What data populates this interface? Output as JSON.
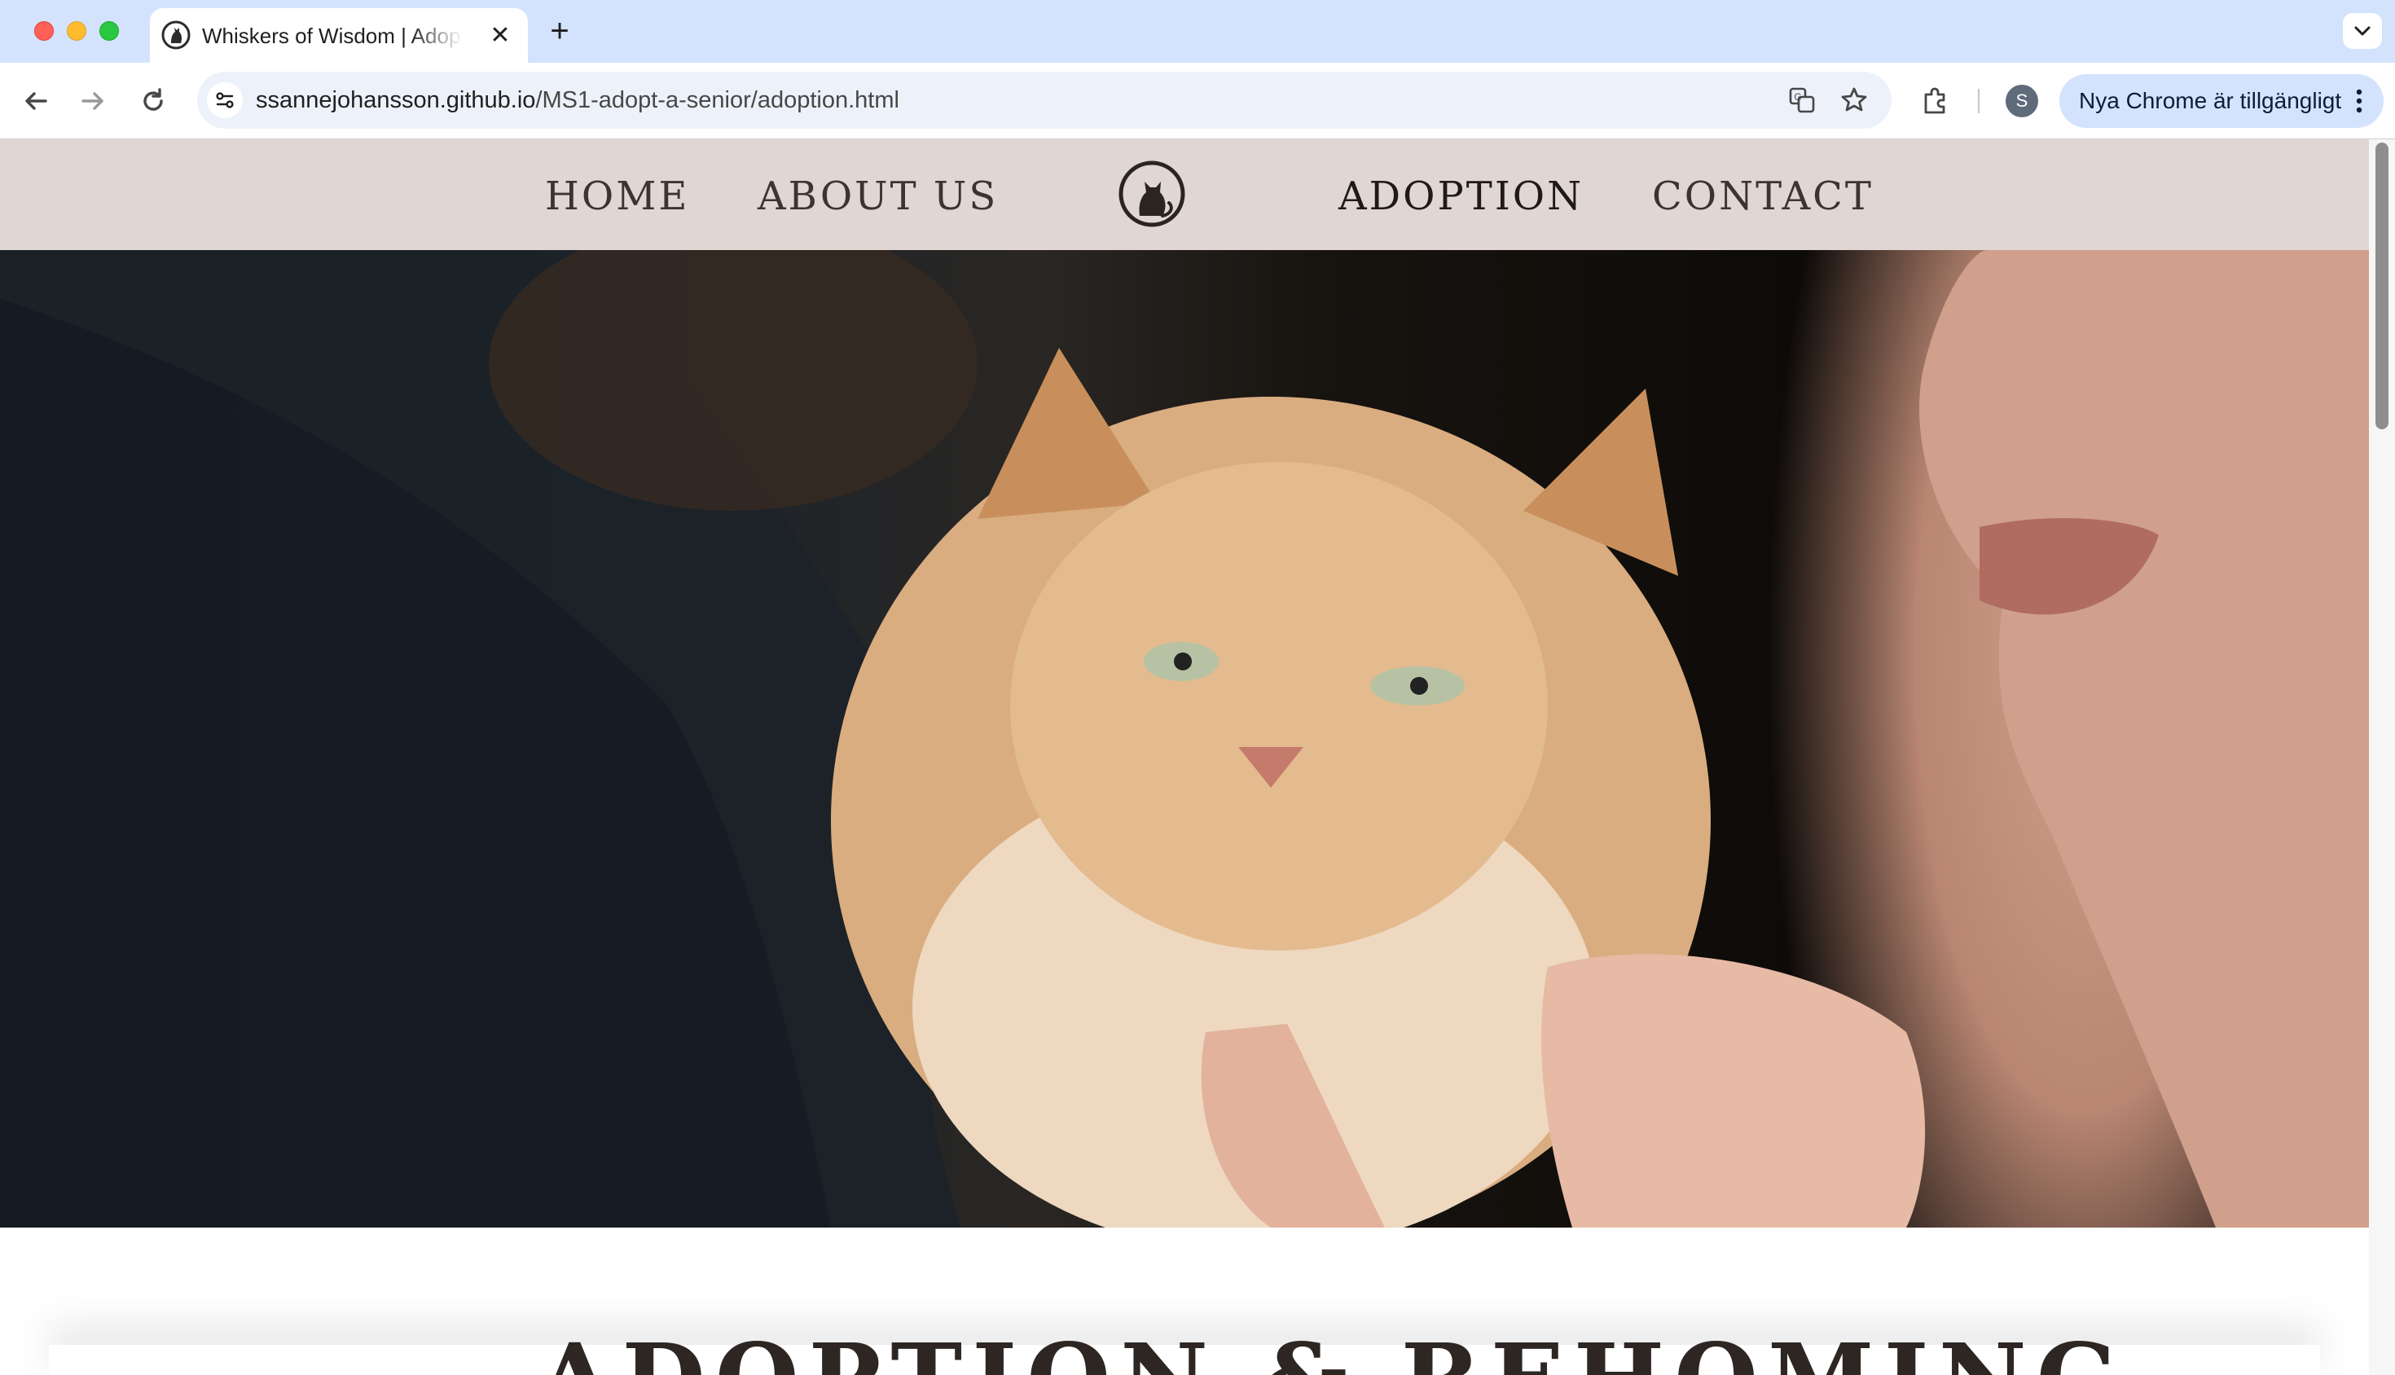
{
  "browser": {
    "tab": {
      "title": "Whiskers of Wisdom | Adoption",
      "close_glyph": "✕"
    },
    "new_tab_glyph": "+",
    "address_bar": {
      "url_host": "ssannejohansson.github.io",
      "url_path": "/MS1-adopt-a-senior/adoption.html"
    },
    "profile_initial": "S",
    "update_button_label": "Nya Chrome är tillgängligt",
    "icons": [
      "back-icon",
      "forward-icon",
      "reload-icon",
      "site-info-icon",
      "translate-icon",
      "bookmark-star-icon",
      "extensions-icon",
      "kebab-menu-icon",
      "tab-list-chevron-icon"
    ]
  },
  "site": {
    "nav": {
      "home": "HOME",
      "about": "ABOUT US",
      "adoption": "ADOPTION",
      "contact": "CONTACT",
      "logo_icon": "cat-logo-icon"
    },
    "hero_image": "photo of a fluffy ginger cat held by two people",
    "heading": "ADOPTION & REHOMING"
  },
  "colors": {
    "navbar_bg": "#e0d6d4",
    "nav_text": "#3b3430",
    "tabbar_bg": "#d3e3fd"
  }
}
